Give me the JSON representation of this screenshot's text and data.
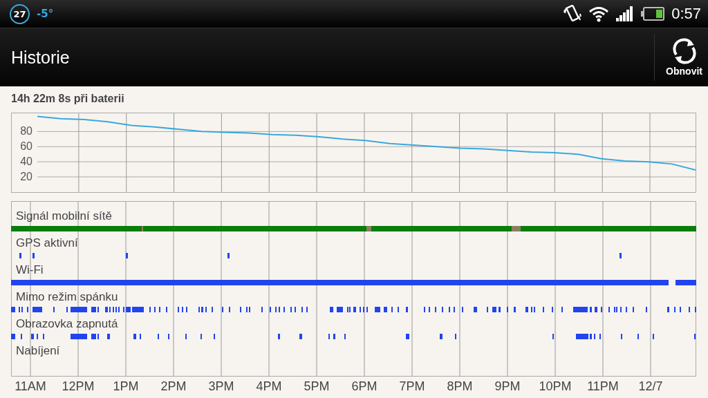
{
  "status_bar": {
    "battery_badge": "27",
    "temperature": "-5°",
    "time": "0:57"
  },
  "action_bar": {
    "title": "Historie",
    "refresh_button": "Obnovit"
  },
  "summary": "14h 22m 8s při baterii",
  "battery_chart": {
    "chart_data": {
      "type": "line",
      "ylim": [
        0,
        104
      ],
      "yticks": [
        20,
        40,
        60,
        80
      ],
      "grid": true,
      "series": [
        {
          "color": "#3aa8dc",
          "values": [
            100,
            97,
            96,
            93,
            88,
            86,
            83,
            80,
            79,
            78,
            76,
            75,
            73,
            70,
            68,
            64,
            62,
            60,
            58,
            57,
            55,
            53,
            52,
            50,
            44,
            41,
            40,
            37,
            29
          ]
        }
      ],
      "categories": [
        null,
        null,
        null,
        null,
        null,
        null,
        null,
        null,
        null,
        null,
        null,
        null,
        null,
        null,
        null,
        null,
        null,
        null,
        null,
        null,
        null,
        null,
        null,
        null,
        null,
        null,
        null,
        null,
        null
      ]
    }
  },
  "tracks": [
    {
      "label": "Signál mobilní sítě",
      "color": "#0b7d0b"
    },
    {
      "label": "GPS aktivní",
      "color": "#2244ee"
    },
    {
      "label": "Wi-Fi",
      "color": "#2244ee"
    },
    {
      "label": "Mimo režim spánku",
      "color": "#2244ee"
    },
    {
      "label": "Obrazovka zapnutá",
      "color": "#2244ee"
    },
    {
      "label": "Nabíjení"
    }
  ],
  "time_axis": [
    "11AM",
    "12PM",
    "1PM",
    "2PM",
    "3PM",
    "4PM",
    "5PM",
    "6PM",
    "7PM",
    "8PM",
    "9PM",
    "10PM",
    "11PM",
    "12/7"
  ]
}
